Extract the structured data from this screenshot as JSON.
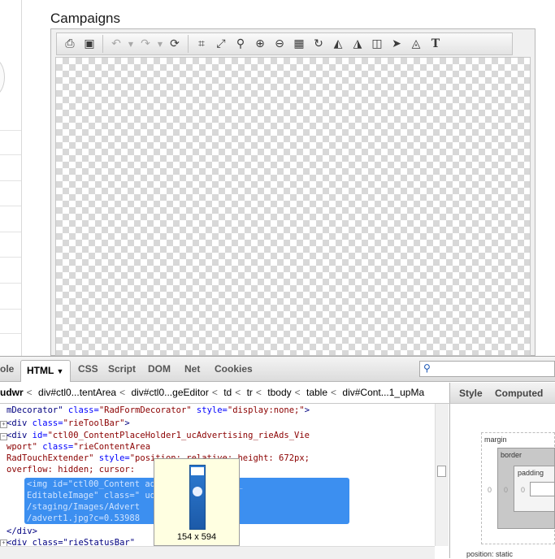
{
  "page": {
    "title": "Campaigns"
  },
  "toolbar_icons": [
    "print-icon",
    "save-icon",
    "undo-icon",
    "undo-dropdown-icon",
    "redo-icon",
    "redo-dropdown-icon",
    "reset-icon",
    "crop-icon",
    "resize-icon",
    "zoom-icon",
    "zoom-in-icon",
    "zoom-out-icon",
    "opacity-icon",
    "rotate-icon",
    "flip-horizontal-icon",
    "flip-vertical-icon",
    "flip-icon",
    "send-icon",
    "mirror-icon",
    "add-text-icon"
  ],
  "firebug": {
    "tabs": {
      "console": "ole",
      "html": "HTML",
      "css": "CSS",
      "script": "Script",
      "dom": "DOM",
      "net": "Net",
      "cookies": "Cookies"
    },
    "breadcrumb": [
      "udwr",
      "div#ctl0...tentArea",
      "div#ctl0...geEditor",
      "td",
      "tr",
      "tbody",
      "table",
      "div#Cont...1_upMa"
    ],
    "side_tabs": {
      "style": "Style",
      "computed": "Computed"
    },
    "source": {
      "line1": {
        "a": "mDecorator\"",
        "b": " class=",
        "c": "\"RadFormDecorator\"",
        "d": " style=",
        "e": "\"display:none;\"",
        "f": ">"
      },
      "line2": {
        "a": "<div",
        "b": " class=",
        "c": "\"rieToolBar\"",
        "d": ">"
      },
      "line3": {
        "a": "<div",
        "b": " id=",
        "c": "\"ctl00_ContentPlaceHolder1_ucAdvertising_rieAds_Vie"
      },
      "line4": {
        "a": "wport\"",
        "b": " class=",
        "c": "\"rieContentArea"
      },
      "line5": {
        "a": "RadTouchExtender\"",
        "b": " style=",
        "c": "\"position: relative; height: 672px;"
      },
      "line6": {
        "a": "overflow: hidden; cursor:"
      },
      "sel1": "<img id=\"ctl00_Content                  advertising_rieAds_",
      "sel2": "EditableImage\" class=\"                 udwr\" alt=\"\" src=\"",
      "sel3": "/staging/Images/Advert",
      "sel4": "/advert1.jpg?c=0.53988",
      "line7": "</div>",
      "line8": "<div class=\"rieStatusBar\""
    },
    "preview": {
      "size": "154 x 594"
    },
    "layout": {
      "margin": "margin",
      "border": "border",
      "padding": "padding",
      "zero": "0",
      "position": "position: static"
    }
  }
}
